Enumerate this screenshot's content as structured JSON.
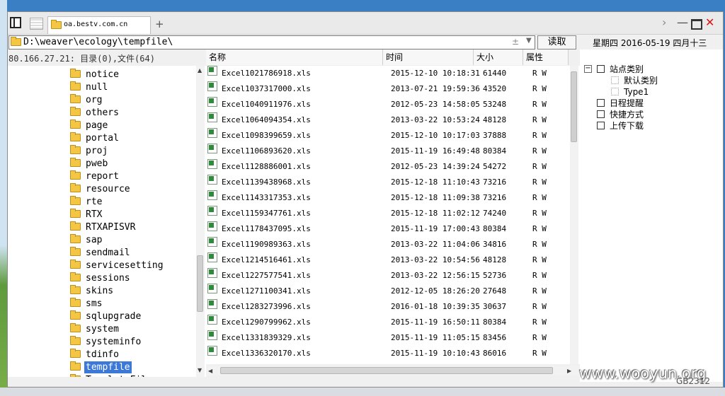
{
  "tab": {
    "title": "oa.bestv.com.cn",
    "new_tab": "+"
  },
  "controls": {
    "chevron": "›",
    "minimize": "—",
    "close": "✕"
  },
  "path": {
    "value": "D:\\weaver\\ecology\\tempfile\\",
    "pm": "±",
    "dropdown": "▼",
    "read_button": "读取"
  },
  "datebar": {
    "text": "星期四 2016-05-19 四月十三"
  },
  "host": {
    "info": "80.166.27.21:    目录(0),文件(64)"
  },
  "columns": {
    "name": "名称",
    "time": "时间",
    "size": "大小",
    "attr": "属性"
  },
  "tree": {
    "items": [
      "notice",
      "null",
      "org",
      "others",
      "page",
      "portal",
      "proj",
      "pweb",
      "report",
      "resource",
      "rte",
      "RTX",
      "RTXAPISVR",
      "sap",
      "sendmail",
      "servicesetting",
      "sessions",
      "skins",
      "sms",
      "sqlupgrade",
      "system",
      "systeminfo",
      "tdinfo",
      "tempfile",
      "TemplateFile"
    ],
    "selected": "tempfile"
  },
  "files": [
    {
      "name": "Excel1021786918.xls",
      "time": "2015-12-10 10:18:31",
      "size": "61440",
      "attr": "R W"
    },
    {
      "name": "Excel1037317000.xls",
      "time": "2013-07-21 19:59:36",
      "size": "43520",
      "attr": "R W"
    },
    {
      "name": "Excel1040911976.xls",
      "time": "2012-05-23 14:58:05",
      "size": "53248",
      "attr": "R W"
    },
    {
      "name": "Excel1064094354.xls",
      "time": "2013-03-22 10:53:24",
      "size": "48128",
      "attr": "R W"
    },
    {
      "name": "Excel1098399659.xls",
      "time": "2015-12-10 10:17:03",
      "size": "37888",
      "attr": "R W"
    },
    {
      "name": "Excel1106893620.xls",
      "time": "2015-11-19 16:49:48",
      "size": "80384",
      "attr": "R W"
    },
    {
      "name": "Excel1128886001.xls",
      "time": "2012-05-23 14:39:24",
      "size": "54272",
      "attr": "R W"
    },
    {
      "name": "Excel1139438968.xls",
      "time": "2015-12-18 11:10:43",
      "size": "73216",
      "attr": "R W"
    },
    {
      "name": "Excel1143317353.xls",
      "time": "2015-12-18 11:09:38",
      "size": "73216",
      "attr": "R W"
    },
    {
      "name": "Excel1159347761.xls",
      "time": "2015-12-18 11:02:12",
      "size": "74240",
      "attr": "R W"
    },
    {
      "name": "Excel1178437095.xls",
      "time": "2015-11-19 17:00:43",
      "size": "80384",
      "attr": "R W"
    },
    {
      "name": "Excel1190989363.xls",
      "time": "2013-03-22 11:04:06",
      "size": "34816",
      "attr": "R W"
    },
    {
      "name": "Excel1214516461.xls",
      "time": "2013-03-22 10:54:56",
      "size": "48128",
      "attr": "R W"
    },
    {
      "name": "Excel1227577541.xls",
      "time": "2013-03-22 12:56:15",
      "size": "52736",
      "attr": "R W"
    },
    {
      "name": "Excel1271100341.xls",
      "time": "2012-12-05 18:26:20",
      "size": "27648",
      "attr": "R W"
    },
    {
      "name": "Excel1283273996.xls",
      "time": "2016-01-18 10:39:35",
      "size": "30637",
      "attr": "R W"
    },
    {
      "name": "Excel1290799962.xls",
      "time": "2015-11-19 16:50:11",
      "size": "80384",
      "attr": "R W"
    },
    {
      "name": "Excel1331839329.xls",
      "time": "2015-11-19 11:05:15",
      "size": "83456",
      "attr": "R W"
    },
    {
      "name": "Excel1336320170.xls",
      "time": "2015-11-19 10:10:43",
      "size": "86016",
      "attr": "R W"
    }
  ],
  "right_panel": {
    "items": [
      {
        "label": "站点类别",
        "icon": "site-category-icon",
        "level": 0,
        "expander": "−"
      },
      {
        "label": "默认类别",
        "icon": "category-icon",
        "level": 1
      },
      {
        "label": "Type1",
        "icon": "category-icon",
        "level": 1
      },
      {
        "label": "日程提醒",
        "icon": "schedule-icon",
        "level": 0
      },
      {
        "label": "快捷方式",
        "icon": "shortcut-icon",
        "level": 0
      },
      {
        "label": "上传下载",
        "icon": "upload-download-icon",
        "level": 0
      }
    ]
  },
  "watermark": "www.wooyun.org",
  "encoding": "GB2312"
}
